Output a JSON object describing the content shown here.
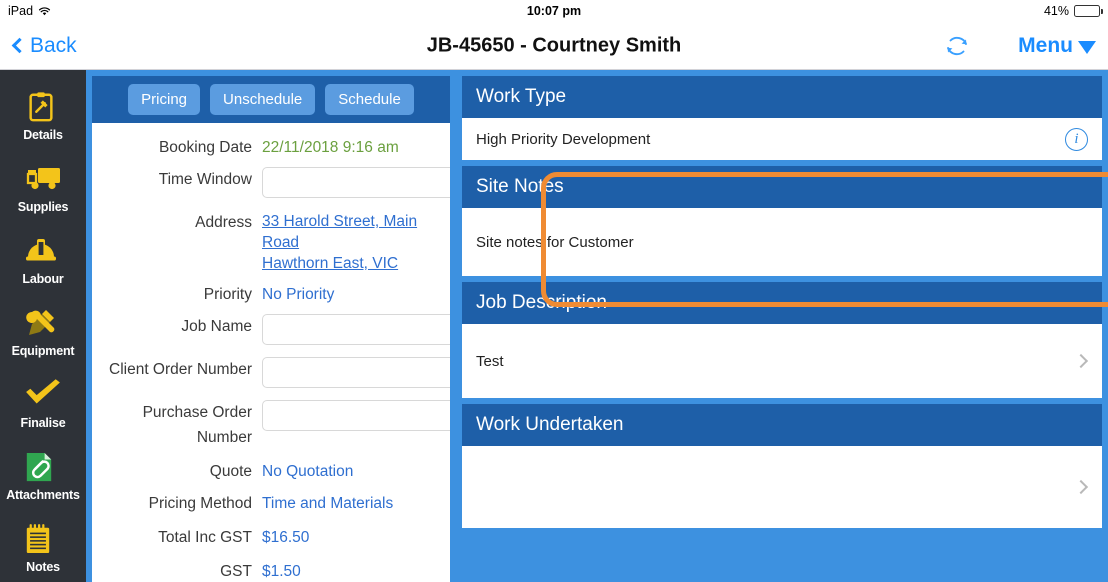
{
  "status_bar": {
    "device": "iPad",
    "wifi_icon": "wifi-icon",
    "time": "10:07 pm",
    "battery_percent": "41%",
    "battery_level": 41
  },
  "nav": {
    "back_label": "Back",
    "back_icon": "chevron-left-icon",
    "title": "JB-45650 - Courtney Smith",
    "refresh_icon": "sync-refresh-icon",
    "menu_label": "Menu",
    "menu_caret_icon": "caret-down-icon"
  },
  "sidebar": {
    "items": [
      {
        "label": "Details",
        "icon": "clipboard-icon"
      },
      {
        "label": "Supplies",
        "icon": "truck-icon"
      },
      {
        "label": "Labour",
        "icon": "hard-hat-icon"
      },
      {
        "label": "Equipment",
        "icon": "wrench-hammer-icon"
      },
      {
        "label": "Finalise",
        "icon": "check-mark-icon"
      },
      {
        "label": "Attachments",
        "icon": "paperclip-document-icon"
      },
      {
        "label": "Notes",
        "icon": "notepad-icon"
      }
    ]
  },
  "form": {
    "toolbar": {
      "pricing_label": "Pricing",
      "unschedule_label": "Unschedule",
      "schedule_label": "Schedule"
    },
    "fields": {
      "booking_date_label": "Booking Date",
      "booking_date_value": "22/11/2018 9:16 am",
      "time_window_label": "Time Window",
      "time_window_value": "",
      "time_window_placeholder": "",
      "address_label": "Address",
      "address_line1": "33 Harold Street, Main",
      "address_line2": "Road",
      "address_line3": "Hawthorn East, VIC",
      "priority_label": "Priority",
      "priority_value": "No Priority",
      "job_name_label": "Job Name",
      "job_name_value": "",
      "client_order_label": "Client Order Number",
      "client_order_value": "",
      "purchase_order_label": "Purchase Order Number",
      "purchase_order_value": "",
      "quote_label": "Quote",
      "quote_value": "No Quotation",
      "pricing_method_label": "Pricing Method",
      "pricing_method_value": "Time and Materials",
      "total_inc_gst_label": "Total Inc GST",
      "total_inc_gst_value": "$16.50",
      "gst_label": "GST",
      "gst_value": "$1.50"
    }
  },
  "detail_cards": {
    "work_type": {
      "title": "Work Type",
      "value": "High Priority Development",
      "info_icon": "info-circle-icon"
    },
    "site_notes": {
      "title": "Site Notes",
      "value": "Site notes for Customer",
      "highlighted": true
    },
    "job_description": {
      "title": "Job Description",
      "value": "Test",
      "chevron_icon": "chevron-right-icon"
    },
    "work_undertaken": {
      "title": "Work Undertaken",
      "value": "",
      "chevron_icon": "chevron-right-icon"
    }
  },
  "colors": {
    "header_blue": "#1e5fa8",
    "panel_border_blue": "#3d91e0",
    "button_blue": "#5b9ce0",
    "link_blue": "#2f6fd0",
    "ios_blue": "#1a8cff",
    "sidebar_dark": "#2e3238",
    "sidebar_icon_yellow": "#f3c41a",
    "attachment_green": "#30a650",
    "date_green": "#6ba03f",
    "highlight_orange": "#ef8b33"
  }
}
